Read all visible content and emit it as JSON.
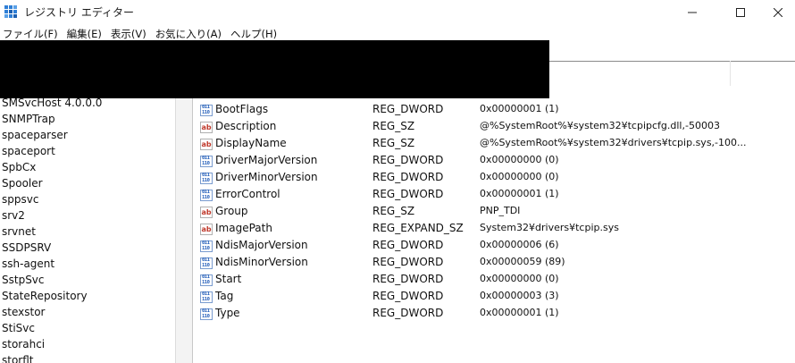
{
  "window": {
    "title": "レジストリ エディター"
  },
  "menu": [
    "ファイル(F)",
    "編集(E)",
    "表示(V)",
    "お気に入り(A)",
    "ヘルプ(H)"
  ],
  "tree": {
    "items": [
      "SMSvcHost 4.0.0.0",
      "SNMPTrap",
      "spaceparser",
      "spaceport",
      "SpbCx",
      "Spooler",
      "sppsvc",
      "srv2",
      "srvnet",
      "SSDPSRV",
      "ssh-agent",
      "SstpSvc",
      "StateRepository",
      "stexstor",
      "StiSvc",
      "storahci",
      "storflt"
    ]
  },
  "values": {
    "rows": [
      {
        "icon": "binary-value-icon",
        "name": "BootFlags",
        "type": "REG_DWORD",
        "data": "0x00000001 (1)"
      },
      {
        "icon": "string-value-icon",
        "name": "Description",
        "type": "REG_SZ",
        "data": "@%SystemRoot%¥system32¥tcpipcfg.dll,-50003"
      },
      {
        "icon": "string-value-icon",
        "name": "DisplayName",
        "type": "REG_SZ",
        "data": "@%SystemRoot%¥system32¥drivers¥tcpip.sys,-100..."
      },
      {
        "icon": "binary-value-icon",
        "name": "DriverMajorVersion",
        "type": "REG_DWORD",
        "data": "0x00000000 (0)"
      },
      {
        "icon": "binary-value-icon",
        "name": "DriverMinorVersion",
        "type": "REG_DWORD",
        "data": "0x00000000 (0)"
      },
      {
        "icon": "binary-value-icon",
        "name": "ErrorControl",
        "type": "REG_DWORD",
        "data": "0x00000001 (1)"
      },
      {
        "icon": "string-value-icon",
        "name": "Group",
        "type": "REG_SZ",
        "data": "PNP_TDI"
      },
      {
        "icon": "string-value-icon",
        "name": "ImagePath",
        "type": "REG_EXPAND_SZ",
        "data": "System32¥drivers¥tcpip.sys"
      },
      {
        "icon": "binary-value-icon",
        "name": "NdisMajorVersion",
        "type": "REG_DWORD",
        "data": "0x00000006 (6)"
      },
      {
        "icon": "binary-value-icon",
        "name": "NdisMinorVersion",
        "type": "REG_DWORD",
        "data": "0x00000059 (89)"
      },
      {
        "icon": "binary-value-icon",
        "name": "Start",
        "type": "REG_DWORD",
        "data": "0x00000000 (0)"
      },
      {
        "icon": "binary-value-icon",
        "name": "Tag",
        "type": "REG_DWORD",
        "data": "0x00000003 (3)"
      },
      {
        "icon": "binary-value-icon",
        "name": "Type",
        "type": "REG_DWORD",
        "data": "0x00000001 (1)"
      }
    ]
  },
  "colors": {
    "redaction": "#000000",
    "binary_icon": "#1e5ab8",
    "string_icon": "#c0392b"
  }
}
